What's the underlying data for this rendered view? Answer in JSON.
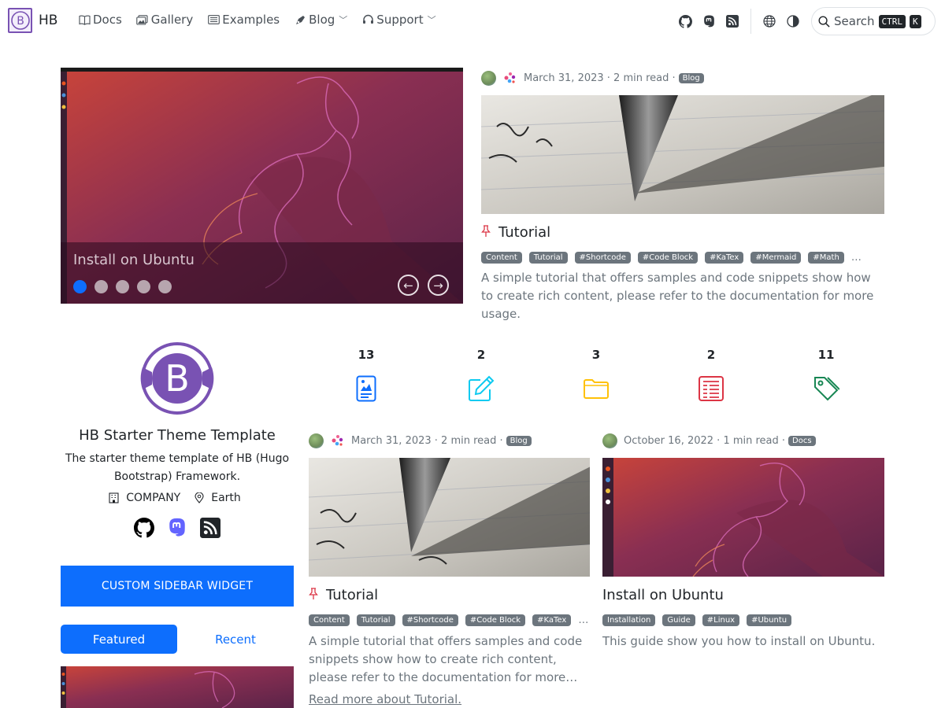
{
  "brand": {
    "name": "HB"
  },
  "nav": {
    "items": [
      {
        "label": "Docs",
        "icon": "book-icon"
      },
      {
        "label": "Gallery",
        "icon": "images-icon"
      },
      {
        "label": "Examples",
        "icon": "list-icon"
      },
      {
        "label": "Blog",
        "icon": "blog-icon",
        "dropdown": true
      },
      {
        "label": "Support",
        "icon": "support-icon",
        "dropdown": true
      }
    ],
    "search_label": "Search",
    "shortcut_ctrl": "CTRL",
    "shortcut_key": "K"
  },
  "carousel": {
    "slide_title": "Install on Ubuntu",
    "slide_count": 5,
    "active_index": 0
  },
  "featured_post": {
    "date": "March 31, 2023 · 2 min read ·",
    "badge": "Blog",
    "title": "Tutorial",
    "tags": [
      "Content",
      "Tutorial",
      "#Shortcode",
      "#Code Block",
      "#KaTex",
      "#Mermaid",
      "#Math"
    ],
    "ellipsis": "…",
    "summary": "A simple tutorial that offers samples and code snippets show how to create rich content, please refer to the documentation for more usage."
  },
  "profile": {
    "name": "HB Starter Theme Template",
    "description": "The starter theme template of HB (Hugo Bootstrap) Framework.",
    "company": "COMPANY",
    "location": "Earth"
  },
  "sidebar": {
    "widget_label": "CUSTOM SIDEBAR WIDGET",
    "tab_featured": "Featured",
    "tab_recent": "Recent"
  },
  "stats": [
    {
      "count": "13",
      "icon": "posts-icon",
      "color": "#0d6efd"
    },
    {
      "count": "2",
      "icon": "pencil-square-icon",
      "color": "#0dcaf0"
    },
    {
      "count": "3",
      "icon": "folder-icon",
      "color": "#ffc107"
    },
    {
      "count": "2",
      "icon": "newspaper-icon",
      "color": "#dc3545"
    },
    {
      "count": "11",
      "icon": "tags-icon",
      "color": "#198754"
    }
  ],
  "posts": [
    {
      "date": "March 31, 2023 · 2 min read ·",
      "badge": "Blog",
      "title": "Tutorial",
      "tags": [
        "Content",
        "Tutorial",
        "#Shortcode",
        "#Code Block",
        "#KaTex"
      ],
      "ellipsis": "…",
      "summary_lines": [
        "A simple tutorial that offers samples and code",
        "snippets show how to create rich content,",
        "please refer to the documentation for more…"
      ],
      "read_more": "Read more about Tutorial."
    },
    {
      "date": "October 16, 2022 · 1 min read ·",
      "badge": "Docs",
      "title": "Install on Ubuntu",
      "tags": [
        "Installation",
        "Guide",
        "#Linux",
        "#Ubuntu"
      ],
      "summary": "This guide show you how to install on Ubuntu."
    }
  ],
  "colors": {
    "primary": "#0d6efd",
    "brand_purple": "#7952b3",
    "muted": "#6c757d"
  }
}
